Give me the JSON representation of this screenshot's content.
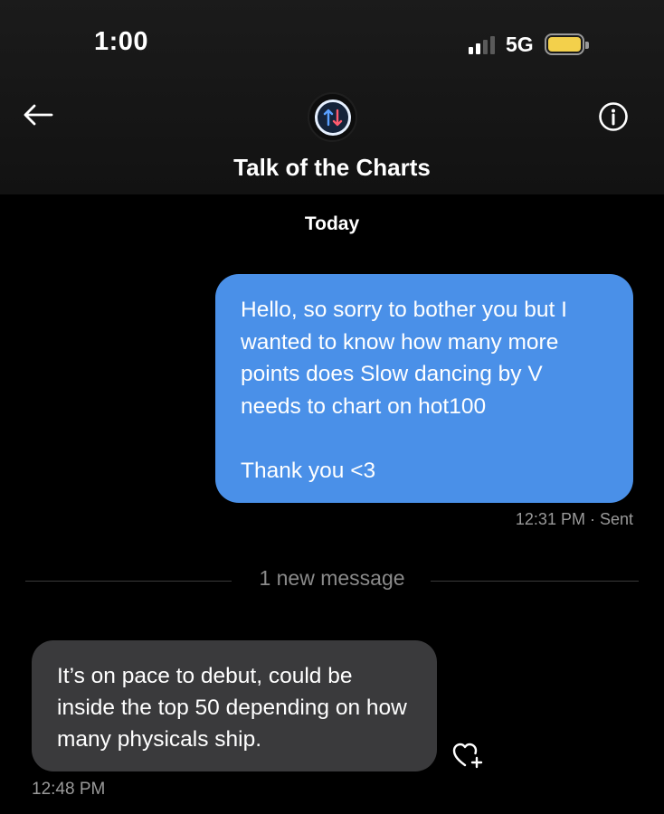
{
  "status_bar": {
    "time": "1:00",
    "network": "5G",
    "signal_bars": 2,
    "signal_total": 4,
    "battery_color": "#f3d04b"
  },
  "header": {
    "title": "Talk of the Charts",
    "back_icon": "arrow-left-icon",
    "info_icon": "info-circle-icon",
    "avatar_icon": "up-down-arrows-icon"
  },
  "conversation": {
    "day_label": "Today",
    "outgoing": {
      "text": "Hello, so sorry to bother you but I wanted to know how many more points does Slow dancing by V needs to chart on hot100\n\nThank you <3",
      "time": "12:31 PM",
      "status": "· Sent",
      "color": "#4a90e8"
    },
    "new_message_divider": "1 new message",
    "incoming": {
      "text": "It’s on pace to debut, could be inside the top 50 depending on how many physicals ship.",
      "time": "12:48 PM",
      "color": "#3a3a3c",
      "react_icon": "heart-plus-icon"
    }
  }
}
